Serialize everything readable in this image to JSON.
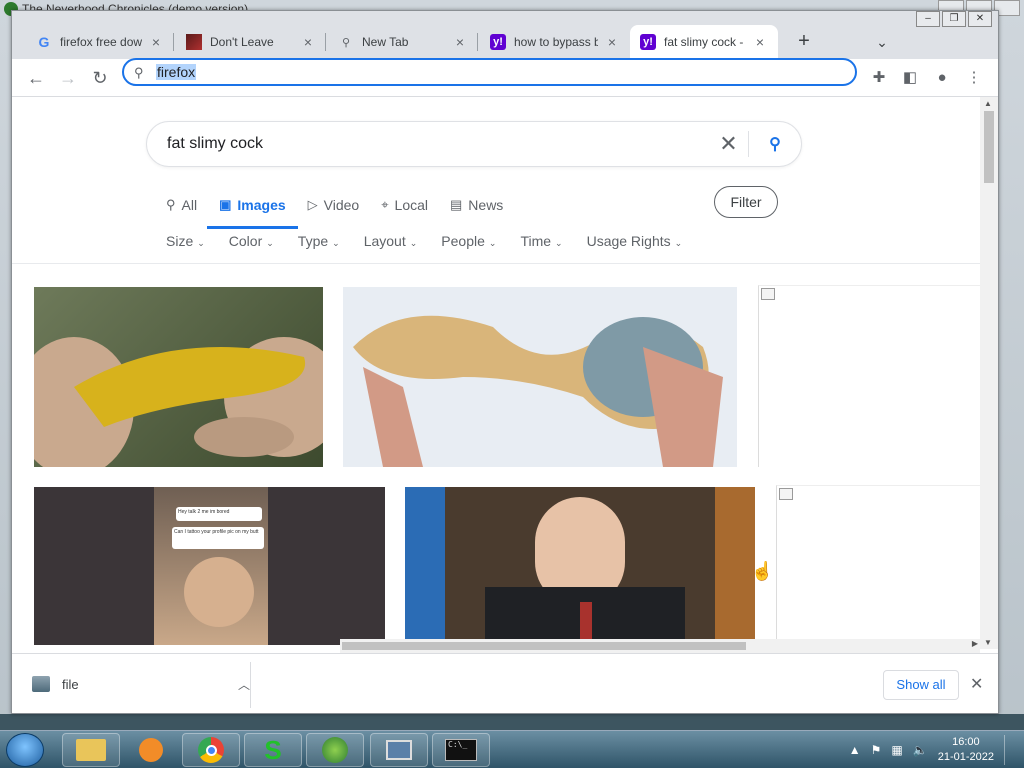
{
  "background_app": {
    "title": "The Neverhood Chronicles (demo version)"
  },
  "tabs": [
    {
      "label": "firefox free dow",
      "icon": "google-icon"
    },
    {
      "label": "Don't Leave",
      "icon": "image-favicon"
    },
    {
      "label": "New Tab",
      "icon": "search-icon"
    },
    {
      "label": "how to bypass b",
      "icon": "yahoo-icon"
    },
    {
      "label": "fat slimy cock - ",
      "icon": "yahoo-icon",
      "active": true
    }
  ],
  "address_bar": {
    "value": "firefox"
  },
  "search": {
    "query": "fat slimy cock"
  },
  "vertical_tabs": [
    {
      "label": "All",
      "icon": "search-icon"
    },
    {
      "label": "Images",
      "icon": "image-icon",
      "active": true
    },
    {
      "label": "Video",
      "icon": "play-icon"
    },
    {
      "label": "Local",
      "icon": "pin-icon"
    },
    {
      "label": "News",
      "icon": "news-icon"
    }
  ],
  "filter_label": "Filter",
  "chips": [
    "Size",
    "Color",
    "Type",
    "Layout",
    "People",
    "Time",
    "Usage Rights"
  ],
  "image_thumb_text": {
    "bubble": "Hey talk 2 me im bored",
    "reply": "Can I tattoo your profile pic on my butt"
  },
  "download": {
    "filename": "file",
    "show_all": "Show all"
  },
  "clock": {
    "time": "16:00",
    "date": "21-01-2022"
  },
  "colors": {
    "accent": "#1a73e8",
    "yahoo": "#6001d2"
  }
}
